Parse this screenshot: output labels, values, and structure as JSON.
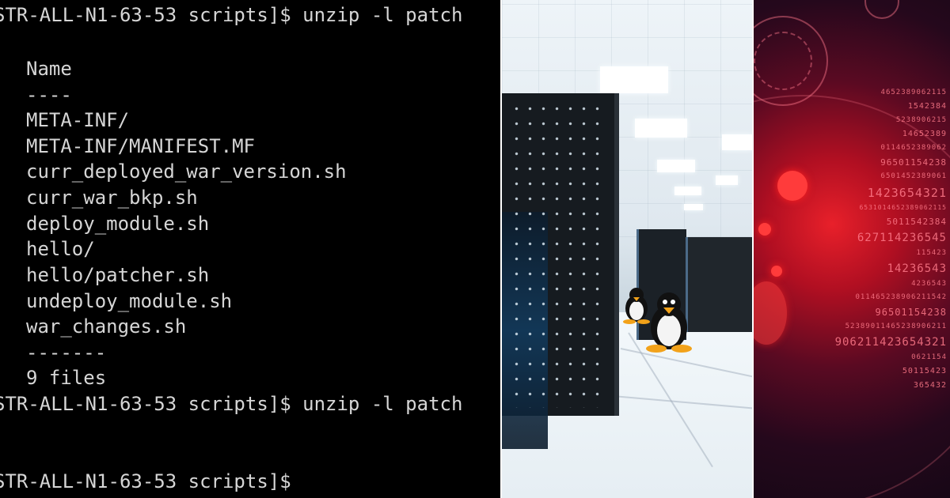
{
  "terminal": {
    "lines": [
      {
        "kind": "prompt",
        "text": "STR-ALL-N1-63-53 scripts]$ unzip -l patch"
      },
      {
        "kind": "out",
        "text": "Name"
      },
      {
        "kind": "out",
        "text": "----"
      },
      {
        "kind": "out",
        "text": "META-INF/"
      },
      {
        "kind": "out",
        "text": "META-INF/MANIFEST.MF"
      },
      {
        "kind": "out",
        "text": "curr_deployed_war_version.sh"
      },
      {
        "kind": "out",
        "text": "curr_war_bkp.sh"
      },
      {
        "kind": "out",
        "text": "deploy_module.sh"
      },
      {
        "kind": "out",
        "text": "hello/"
      },
      {
        "kind": "out",
        "text": "hello/patcher.sh"
      },
      {
        "kind": "out",
        "text": "undeploy_module.sh"
      },
      {
        "kind": "out",
        "text": "war_changes.sh"
      },
      {
        "kind": "out",
        "text": "-------"
      },
      {
        "kind": "out",
        "text": "9 files"
      },
      {
        "kind": "prompt",
        "text": "STR-ALL-N1-63-53 scripts]$ unzip -l patch"
      },
      {
        "kind": "prompt",
        "text": "STR-ALL-N1-63-53 scripts]$"
      }
    ]
  },
  "cyber_numbers": [
    "4652389062115",
    "1542384",
    "5238906215",
    "14652389",
    "0114652389062",
    "96501154238",
    "6501452389061",
    "1423654321",
    "6531014652389062115",
    "5011542384",
    "627114236545",
    "115423",
    "14236543",
    "4236543",
    "011465238906211542",
    "96501154238",
    "52389011465238906211",
    "906211423654321",
    "0621154",
    "50115423",
    "365432"
  ],
  "colors": {
    "terminal_bg": "#000000",
    "terminal_fg": "#d6d6d6",
    "cyber_accent": "#e8202a"
  }
}
